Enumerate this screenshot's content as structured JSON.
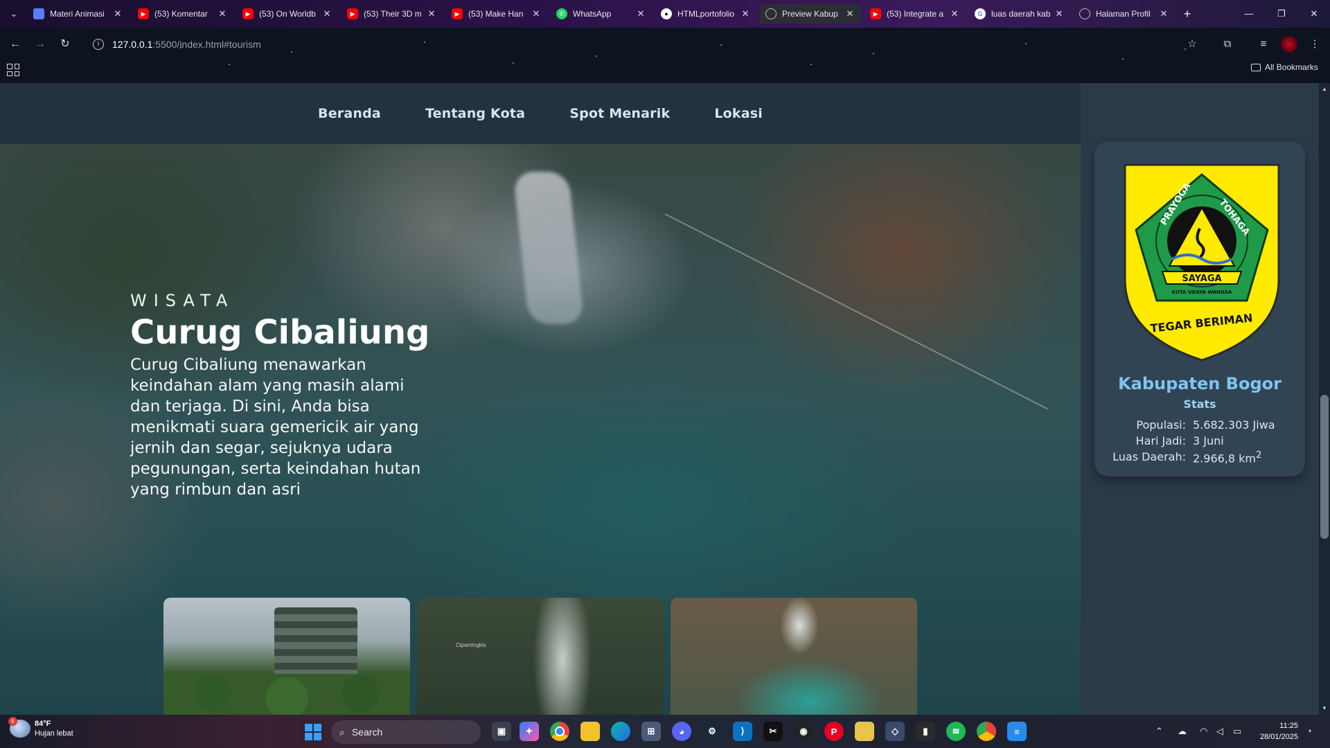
{
  "browser": {
    "tabs": [
      {
        "title": "Materi Animasi",
        "icon": "shield-icon"
      },
      {
        "title": "(53) Komentar",
        "icon": "youtube-icon"
      },
      {
        "title": "(53) On Worldb",
        "icon": "youtube-icon"
      },
      {
        "title": "(53) Their 3D m",
        "icon": "youtube-icon"
      },
      {
        "title": "(53) Make Han",
        "icon": "youtube-icon"
      },
      {
        "title": "WhatsApp",
        "icon": "whatsapp-icon"
      },
      {
        "title": "HTMLportofolio",
        "icon": "github-icon"
      },
      {
        "title": "Preview Kabup",
        "icon": "globe-icon"
      },
      {
        "title": "(53) Integrate a",
        "icon": "youtube-icon"
      },
      {
        "title": "luas daerah kab",
        "icon": "google-icon"
      },
      {
        "title": "Halaman Profil",
        "icon": "globe-icon"
      }
    ],
    "active_tab": 7,
    "url_host": "127.0.0.1",
    "url_path": ":5500/index.html#tourism",
    "bookmarks_label": "All Bookmarks"
  },
  "site": {
    "nav": [
      "Beranda",
      "Tentang Kota",
      "Spot Menarik",
      "Lokasi"
    ],
    "hero": {
      "eyebrow": "WISATA",
      "title": "Curug Cibaliung",
      "description": "Curug Cibaliung menawarkan keindahan alam yang masih alami dan terjaga. Di sini, Anda bisa menikmati suara gemericik air yang jernih dan segar, sejuknya udara pegunungan, serta keindahan hutan yang rimbun dan asri"
    },
    "cards": [
      {
        "label": ""
      },
      {
        "label": "Cipamingkis"
      },
      {
        "label": ""
      }
    ],
    "sidebar": {
      "emblem": {
        "top_text_left": "PRAYOGA",
        "top_text_right": "TOHAGA",
        "banner": "SAYAGA",
        "sub_banner": "KUTA UDAYA WANGSA",
        "motto": "TEGAR BERIMAN"
      },
      "region": "Kabupaten Bogor",
      "stats_title": "Stats",
      "stats": [
        {
          "key": "Populasi:",
          "value": "5.682.303 Jiwa"
        },
        {
          "key": "Hari Jadi:",
          "value": "3 Juni"
        },
        {
          "key": "Luas Daerah:",
          "value": "2.966,8 km",
          "sup": "2"
        }
      ]
    }
  },
  "taskbar": {
    "weather_temp": "84°F",
    "weather_desc": "Hujan lebat",
    "weather_badge": "6",
    "search_label": "Search",
    "time": "11:25",
    "date": "28/01/2025"
  },
  "colors": {
    "accent": "#7fc4f2",
    "navbar": "#243140",
    "sidebar": "#2b3a48"
  }
}
